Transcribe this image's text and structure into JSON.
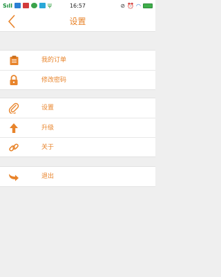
{
  "status_bar": {
    "time": "16:57",
    "left_text": "Sıll"
  },
  "header": {
    "title": "设置"
  },
  "menu": {
    "group1": [
      {
        "label": "我的订单",
        "icon": "clipboard-icon"
      },
      {
        "label": "修改密码",
        "icon": "lock-icon"
      }
    ],
    "group2": [
      {
        "label": "设置",
        "icon": "paperclip-icon"
      },
      {
        "label": "升级",
        "icon": "arrow-up-icon"
      },
      {
        "label": "关于",
        "icon": "link-icon"
      }
    ],
    "group3": [
      {
        "label": "退出",
        "icon": "exit-arrow-icon"
      }
    ]
  },
  "colors": {
    "accent": "#e8842b",
    "background": "#efefef",
    "surface": "#ffffff"
  }
}
